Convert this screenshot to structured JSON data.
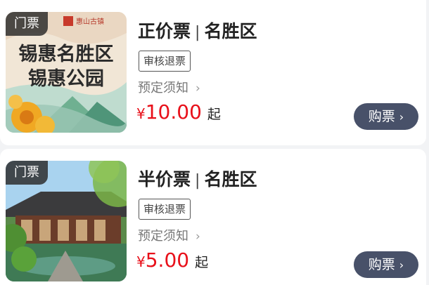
{
  "tickets": [
    {
      "tag": "门票",
      "name": "正价票",
      "separator": "|",
      "area": "名胜区",
      "refund": "审核退票",
      "notice": "预定须知",
      "currency": "¥",
      "price": "10.00",
      "from": "起",
      "buy": "购票",
      "image_text": {
        "logo": "惠山古镇",
        "line1": "锡惠名胜区",
        "line2": "锡惠公园"
      }
    },
    {
      "tag": "门票",
      "name": "半价票",
      "separator": "|",
      "area": "名胜区",
      "refund": "审核退票",
      "notice": "预定须知",
      "currency": "¥",
      "price": "5.00",
      "from": "起",
      "buy": "购票"
    }
  ],
  "colors": {
    "price": "#e8101a",
    "button": "#485169",
    "tag_bg": "#282828"
  },
  "icons": {
    "chevron": "chevron-right-icon"
  }
}
